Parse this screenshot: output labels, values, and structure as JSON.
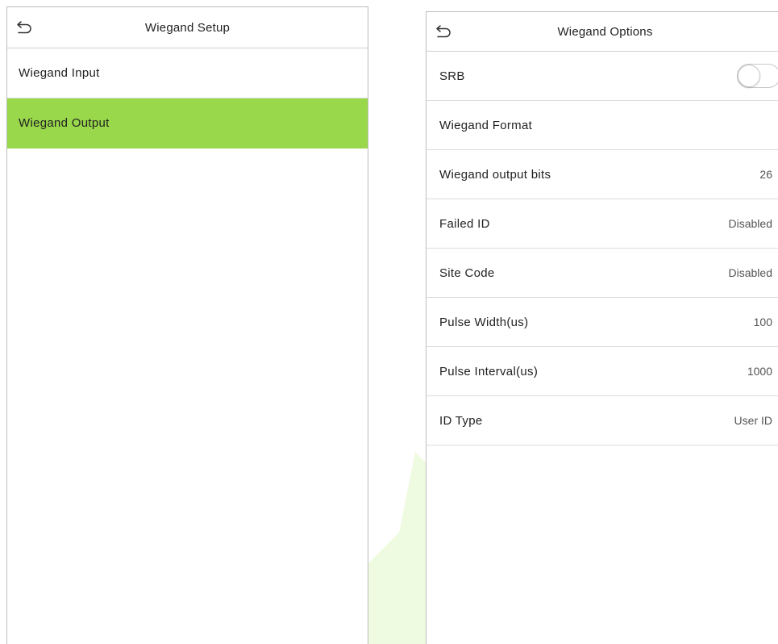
{
  "left_panel": {
    "header": {
      "icon": "back-arrow-icon",
      "title": "Wiegand Setup"
    },
    "items": [
      {
        "label": "Wiegand Input",
        "selected": false
      },
      {
        "label": "Wiegand Output",
        "selected": true
      }
    ]
  },
  "right_panel": {
    "header": {
      "icon": "back-arrow-icon",
      "title": "Wiegand Options"
    },
    "rows": [
      {
        "label": "SRB",
        "value": "",
        "control": "toggle",
        "toggle_on": false
      },
      {
        "label": "Wiegand Format",
        "value": ""
      },
      {
        "label": "Wiegand output bits",
        "value": "26"
      },
      {
        "label": "Failed ID",
        "value": "Disabled"
      },
      {
        "label": "Site Code",
        "value": "Disabled"
      },
      {
        "label": "Pulse Width(us)",
        "value": "100"
      },
      {
        "label": "Pulse Interval(us)",
        "value": "1000"
      },
      {
        "label": "ID Type",
        "value": "User ID"
      }
    ]
  },
  "colors": {
    "selected_row": "#99d74b",
    "watermark": "#e9f9d6"
  }
}
